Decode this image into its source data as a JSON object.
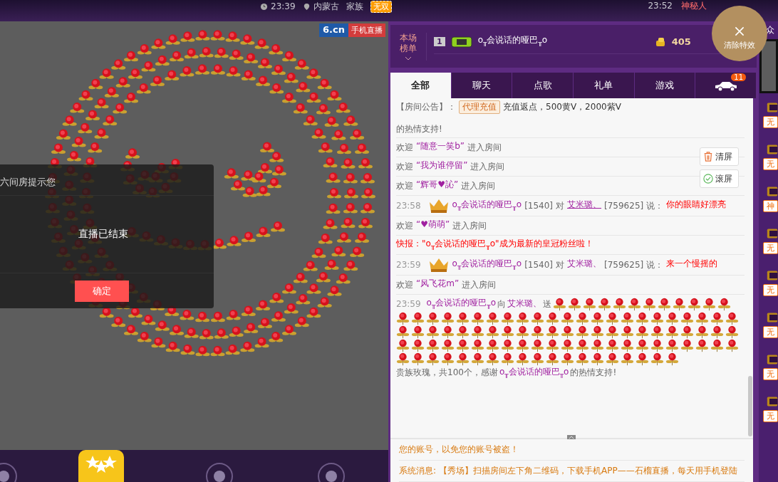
{
  "top_bar": {
    "time": "23:39",
    "location": "内蒙古",
    "family_label": "家族",
    "family_badge": "无双",
    "right_time": "23:52",
    "right_user": "神秘人"
  },
  "video": {
    "logo": "6.cn",
    "mobile_badge": "手机直播",
    "dialog": {
      "title": "六间房提示您",
      "message": "直播已结束",
      "confirm": "确定"
    }
  },
  "ranking": {
    "label": "本场榜单",
    "rank": "1",
    "user": "o$_{╥}$会说话的哑巴$_{╥}$o",
    "coins": "405"
  },
  "clear_effects": "清除特效",
  "tabs": [
    {
      "kind": "text",
      "label": "全部",
      "selected": true
    },
    {
      "kind": "text",
      "label": "聊天",
      "selected": false
    },
    {
      "kind": "text",
      "label": "点歌",
      "selected": false
    },
    {
      "kind": "text",
      "label": "礼单",
      "selected": false
    },
    {
      "kind": "text",
      "label": "游戏",
      "selected": false
    },
    {
      "kind": "car",
      "badge": "11",
      "selected": false
    }
  ],
  "chat_tools": [
    {
      "kind": "clear",
      "label": "清屏"
    },
    {
      "kind": "scroll",
      "label": "滚屏"
    }
  ],
  "messages": [
    {
      "kind": "notice",
      "prefix": "【房间公告】：",
      "tag": "代理充值",
      "text": "充值返点，500黄V，2000紫V"
    },
    {
      "kind": "plain",
      "text": "的热情支持!"
    },
    {
      "kind": "welcome",
      "pre": "欢迎",
      "name": "“随意一笑b”",
      "post": "进入房间"
    },
    {
      "kind": "welcome",
      "pre": "欢迎",
      "name": "“我为谁停留”",
      "post": "进入房间"
    },
    {
      "kind": "welcome",
      "pre": "欢迎",
      "name": "“辉哥♥訫”",
      "post": "进入房间"
    },
    {
      "kind": "chat",
      "time": "23:58",
      "user": "o$_{╥}$会说话的哑巴$_{╥}$o",
      "level": "[1540]",
      "to": "对",
      "target": "艾米璐、",
      "target_id": "[759625]",
      "says": "说：",
      "text": "你的眼睛好漂亮",
      "underlined": true
    },
    {
      "kind": "welcome",
      "pre": "欢迎",
      "name": "“♥萌萌”",
      "post": "进入房间"
    },
    {
      "kind": "flash",
      "text": "快报：\"o$_{╥}$会说话的哑巴$_{╥}$o\"成为最新的皇冠粉丝啦！"
    },
    {
      "kind": "chat",
      "time": "23:59",
      "user": "o$_{╥}$会说话的哑巴$_{╥}$o",
      "level": "[1540]",
      "to": "对",
      "target": "艾米璐、",
      "target_id": "[759625]",
      "says": "说：",
      "text": "来一个慢摇的",
      "underlined": false
    },
    {
      "kind": "welcome",
      "pre": "欢迎",
      "name": "“风飞花m”",
      "post": "进入房间"
    },
    {
      "kind": "gift",
      "time": "23:59",
      "user": "o$_{╥}$会说话的哑巴$_{╥}$o",
      "to": "向",
      "target": "艾米璐、",
      "send": "送",
      "summary": "贵族玫瑰，共100个，感谢",
      "thanks_user": "o$_{╥}$会说话的哑巴$_{╥}$o",
      "thanks": "的热情支持!"
    }
  ],
  "system_messages": [
    {
      "kind": "warning",
      "text": "您的账号，以免您的账号被盗！"
    },
    {
      "kind": "system",
      "prefix": "系统消息:",
      "text": "【秀场】扫描房间左下角二维码，下载手机APP——石榴直播，每天用手机登陆"
    }
  ],
  "sidebar": {
    "title": "众",
    "items": [
      {
        "badge": "无"
      },
      {
        "badge": "无"
      },
      {
        "badge": "神"
      },
      {
        "badge": "无"
      },
      {
        "badge": "无"
      },
      {
        "badge": "无"
      },
      {
        "badge": "无"
      },
      {
        "badge": "无"
      }
    ]
  }
}
